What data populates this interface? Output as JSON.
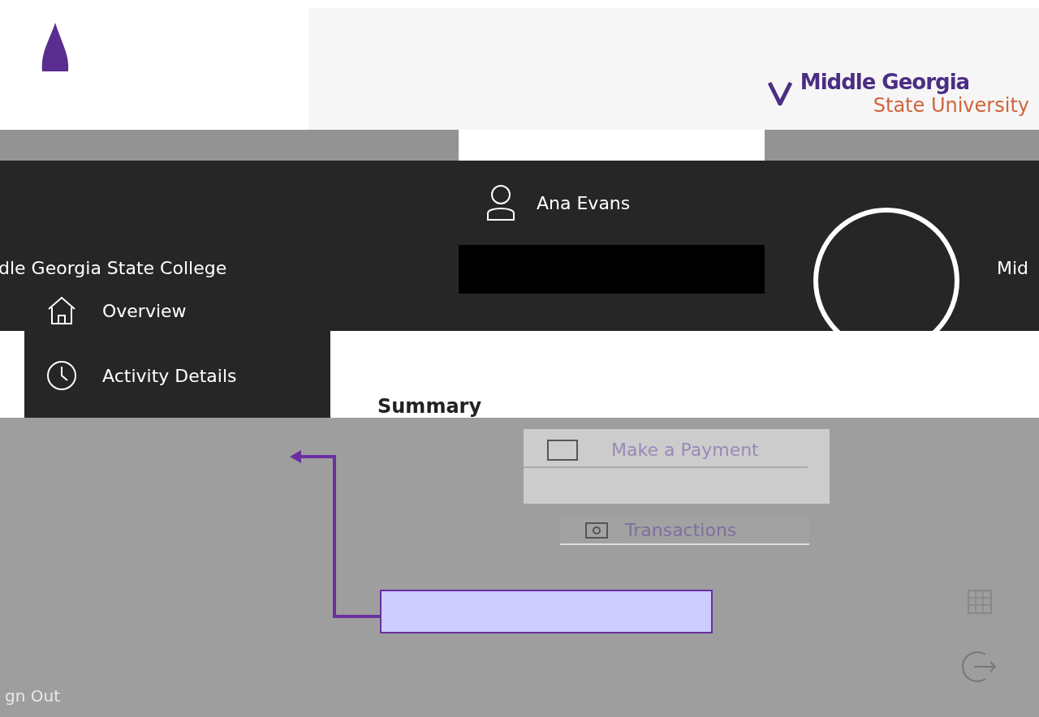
{
  "logo": {
    "line1": "Middle Georgia",
    "line2": "State University"
  },
  "header": {
    "user_name": "Ana Evans",
    "institution": "dle Georgia State College",
    "institution_right": "Mid"
  },
  "menu": [
    {
      "label": "Overview",
      "kind": "home"
    },
    {
      "label": "Activity Details",
      "kind": "clock"
    }
  ],
  "heading": "Summary",
  "payment_button": "Make a Payment",
  "transactions_button": "Transactions",
  "sign_out": "gn Out"
}
